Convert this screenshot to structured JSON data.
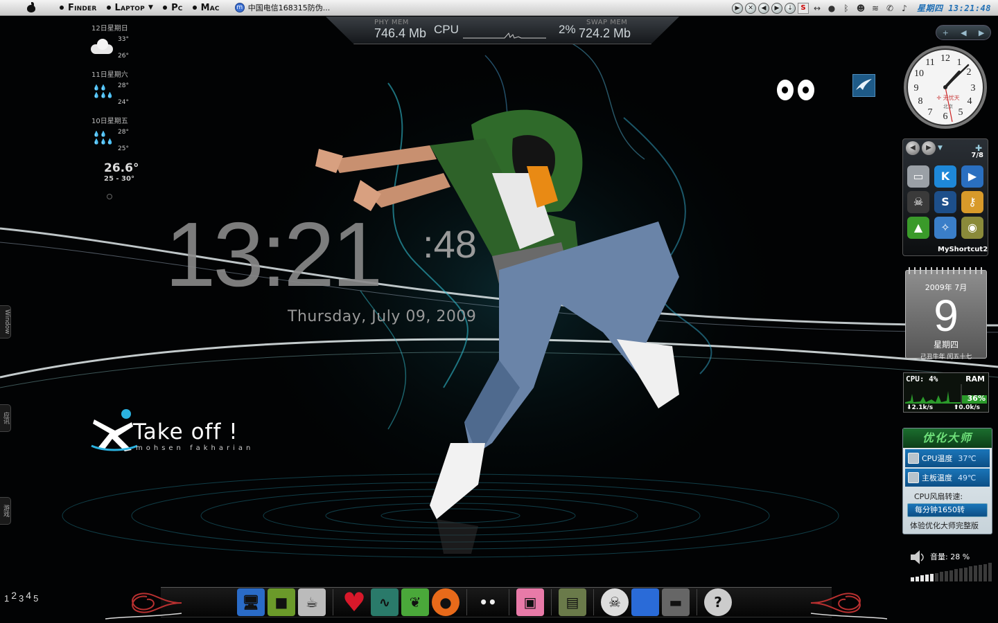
{
  "menubar": {
    "items": [
      {
        "label": "Finder",
        "has_menu": false
      },
      {
        "label": "Laptop",
        "has_menu": true
      },
      {
        "label": "Pc",
        "has_menu": false
      },
      {
        "label": "Mac",
        "has_menu": false
      }
    ],
    "task_tab": "中国电信168315防伪...",
    "tray_clock": "星期四 13:21:48"
  },
  "sysmeter": {
    "phy_label": "PHY MEM",
    "phy_value": "746.4 Mb",
    "cpu_label": "CPU",
    "cpu_pct": "2%",
    "swap_label": "SWAP MEM",
    "swap_value": "724.2 Mb"
  },
  "weather": {
    "days": [
      {
        "date": "12日星期日",
        "high": "33°",
        "low": "26°",
        "icon": "cloud-icon"
      },
      {
        "date": "11日星期六",
        "high": "28°",
        "low": "24°",
        "icon": "rain-icon"
      },
      {
        "date": "10日星期五",
        "high": "28°",
        "low": "25°",
        "icon": "rain-icon"
      }
    ],
    "current": "26.6°",
    "range": "25 - 30°"
  },
  "clock": {
    "hours_minutes": "13:21",
    "seconds": "48",
    "date": "Thursday,  July 09, 2009"
  },
  "logo": {
    "title": "Take off !",
    "author": "mohsen fakharian"
  },
  "sidetabs": {
    "window": "Window",
    "news": "应讯",
    "games": "游戏"
  },
  "shortcuts": {
    "page": "7/8",
    "name": "MyShortcut2",
    "apps": [
      {
        "icon": "drive-icon",
        "color": "#9aa0a6"
      },
      {
        "icon": "kugou-icon",
        "color": "#1e88d8"
      },
      {
        "icon": "kmplayer-icon",
        "color": "#2a6fc0"
      },
      {
        "icon": "alien-icon",
        "color": "#3a3a3a"
      },
      {
        "icon": "swirl-icon",
        "color": "#1d4f8a"
      },
      {
        "icon": "key-icon",
        "color": "#d89a2a"
      },
      {
        "icon": "chart-icon",
        "color": "#3a9a2a"
      },
      {
        "icon": "safari-icon",
        "color": "#3a7ec8"
      },
      {
        "icon": "cd-icon",
        "color": "#8a8a3a"
      }
    ]
  },
  "calendar": {
    "year_month": "2009年 7月",
    "day": "9",
    "weekday": "星期四",
    "lunar": "己丑牛年  闰五十七"
  },
  "perf": {
    "cpu": "CPU: 4%",
    "ram_label": "RAM",
    "ram_pct": "36%",
    "down": "2.1k/s",
    "up": "0.0k/s"
  },
  "optimizer": {
    "title": "优化大师",
    "cpu_temp_label": "CPU温度",
    "cpu_temp": "37℃",
    "board_temp_label": "主板温度",
    "board_temp": "49℃",
    "fan_label": "CPU风扇转速:",
    "fan_value": "每分钟1650转",
    "promo": "体验优化大师完整版"
  },
  "volume": {
    "label": "音量: 28 %",
    "level": 0.28
  },
  "spaces": [
    "1",
    "2",
    "3",
    "4",
    "5"
  ],
  "dock": {
    "groups": [
      [
        "monitor-icon",
        "minecraft-icon",
        "teacup-icon"
      ],
      [
        "heart-icon",
        "activity-monitor-icon",
        "leaf-icon",
        "firefox-icon"
      ],
      [
        "eyes-icon"
      ],
      [
        "photo-pink-icon"
      ],
      [
        "photo-crowd-icon"
      ],
      [
        "skull-icon",
        "apple-icon",
        "usb-drive-icon"
      ],
      [
        "help-icon"
      ]
    ],
    "icon_colors": {
      "monitor-icon": "#2a6bc7",
      "minecraft-icon": "#6b9a2a",
      "teacup-icon": "#bbbbbb",
      "heart-icon": "#d8182a",
      "activity-monitor-icon": "#2a7a6a",
      "leaf-icon": "#4aa83a",
      "firefox-icon": "#e86a1a",
      "eyes-icon": "#eeeeee",
      "photo-pink-icon": "#e87aa8",
      "photo-crowd-icon": "#6a7a4a",
      "skull-icon": "#dddddd",
      "apple-icon": "#2a6bd8",
      "usb-drive-icon": "#666666",
      "help-icon": "#cccccc"
    }
  }
}
